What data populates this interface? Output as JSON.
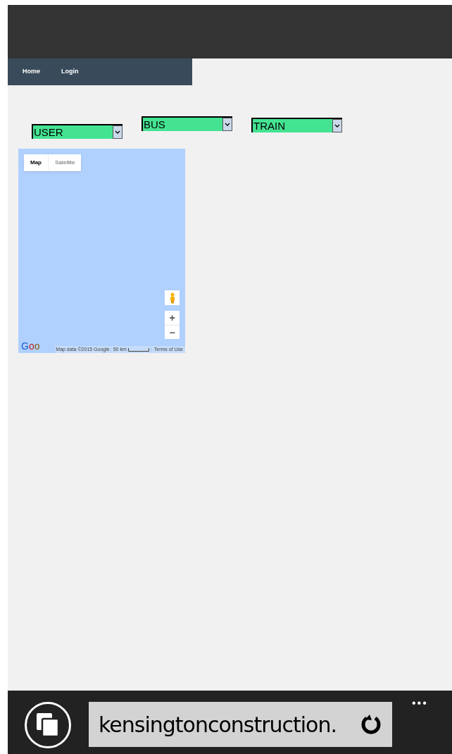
{
  "nav": [
    {
      "label": "Home"
    },
    {
      "label": "Login"
    }
  ],
  "selects": [
    {
      "value": "USER"
    },
    {
      "value": "BUS"
    },
    {
      "value": "TRAIN"
    }
  ],
  "map": {
    "types": [
      {
        "label": "Map",
        "selected": true
      },
      {
        "label": "Satellite",
        "selected": false
      }
    ],
    "logo": "Goo",
    "attribution": "Map data ©2015 Google",
    "scale": "50 km",
    "terms": "Terms of Use",
    "zoom_in": "+",
    "zoom_out": "−"
  },
  "browser": {
    "address": "kensingtonconstruction.",
    "more": "•••"
  }
}
